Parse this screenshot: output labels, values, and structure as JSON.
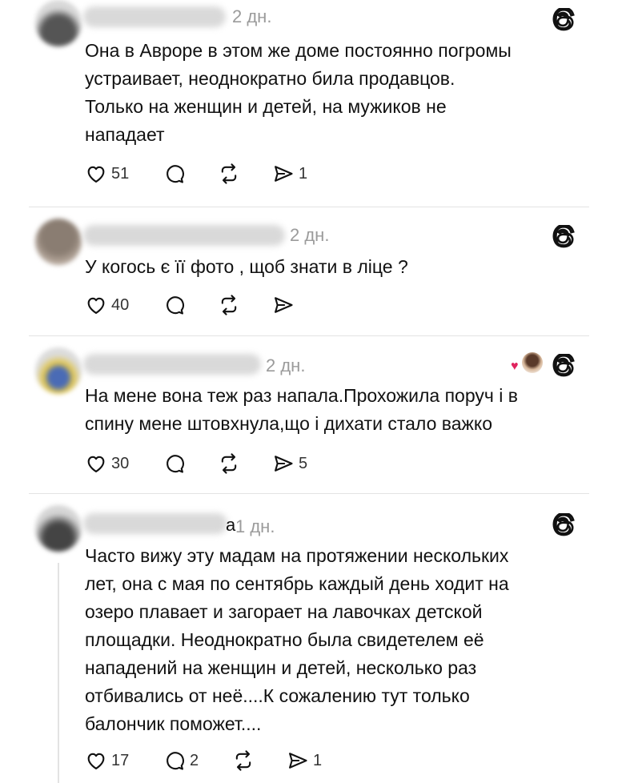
{
  "posts": [
    {
      "time": "2 дн.",
      "text": "Она в Авроре в этом же доме постоянно погромы\nустраивает, неоднократно била продавцов.\nТолько на женщин и детей, на мужиков не\nнападает",
      "likes": "51",
      "replies": "",
      "reposts": "",
      "shares": "1"
    },
    {
      "time": "2 дн.",
      "text": "У когось є її фото , щоб знати в ліце ?",
      "likes": "40",
      "replies": "",
      "reposts": "",
      "shares": ""
    },
    {
      "time": "2 дн.",
      "text": "На мене вона теж раз напала.Прохожила поруч і в\nспину мене штовхнула,що і дихати стало важко",
      "likes": "30",
      "replies": "",
      "reposts": "",
      "shares": "5",
      "reaction_icon": "heart-with-avatar-icon"
    },
    {
      "time": "1 дн.",
      "name_tail": "а",
      "text": "Часто вижу эту мадам на протяжении нескольких\nлет, она с мая по сентябрь каждый день ходит на\nозеро плавает и загорает на лавочках детской\nплощадки. Неоднократно была свидетелем её\nнападений на женщин и детей, несколько раз\nотбивались от неё....К сожалению тут только\nбалончик поможет....",
      "likes": "17",
      "replies": "2",
      "reposts": "",
      "shares": "1"
    }
  ],
  "colors": {
    "accent": "#111111",
    "muted": "#9b9b9b",
    "divider": "#e3e3e3",
    "reaction_heart": "#e0245e"
  },
  "icons": [
    "heart-icon",
    "comment-icon",
    "repost-icon",
    "share-icon",
    "threads-logo-icon"
  ]
}
